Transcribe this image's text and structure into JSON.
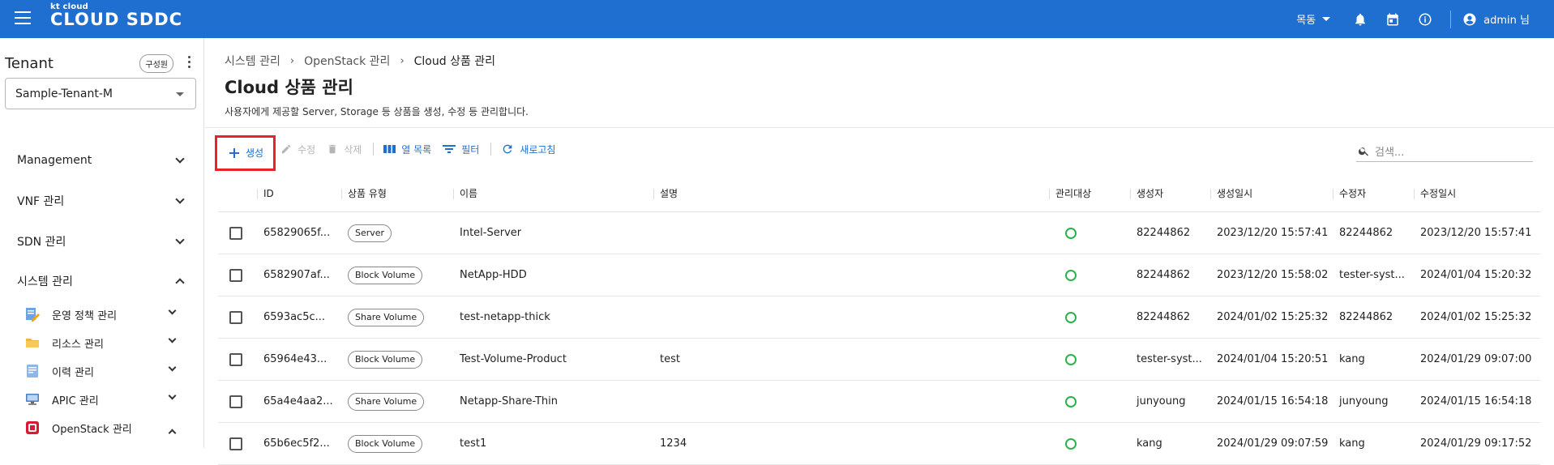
{
  "header": {
    "brand_small": "kt cloud",
    "brand_name": "CLOUD SDDC",
    "region": "목동",
    "user": "admin 님"
  },
  "sidebar": {
    "tenant_label": "Tenant",
    "member_chip": "구성원",
    "tenant_selected": "Sample-Tenant-M",
    "nav": [
      {
        "label": "Management"
      },
      {
        "label": "VNF 관리"
      },
      {
        "label": "SDN 관리"
      },
      {
        "label": "시스템 관리"
      }
    ],
    "sub": [
      {
        "label": "운영 정책 관리"
      },
      {
        "label": "리소스 관리"
      },
      {
        "label": "이력 관리"
      },
      {
        "label": "APIC 관리"
      },
      {
        "label": "OpenStack 관리"
      }
    ]
  },
  "breadcrumb": [
    "시스템 관리",
    "OpenStack 관리",
    "Cloud 상품 관리"
  ],
  "page": {
    "title": "Cloud 상품 관리",
    "description": "사용자에게 제공할 Server, Storage 등 상품을 생성, 수정 등 관리합니다."
  },
  "toolbar": {
    "create": "생성",
    "edit": "수정",
    "delete": "삭제",
    "columns": "열 목록",
    "filter": "필터",
    "refresh": "새로고침",
    "search_placeholder": "검색..."
  },
  "table": {
    "columns": [
      "ID",
      "상품 유형",
      "이름",
      "설명",
      "관리대상",
      "생성자",
      "생성일시",
      "수정자",
      "수정일시"
    ],
    "rows": [
      {
        "id": "65829065f...",
        "type": "Server",
        "name": "Intel-Server",
        "desc": "",
        "managed": true,
        "creator": "82244862",
        "created": "2023/12/20 15:57:41",
        "modifier": "82244862",
        "modified": "2023/12/20 15:57:41"
      },
      {
        "id": "6582907af...",
        "type": "Block Volume",
        "name": "NetApp-HDD",
        "desc": "",
        "managed": true,
        "creator": "82244862",
        "created": "2023/12/20 15:58:02",
        "modifier": "tester-syst...",
        "modified": "2024/01/04 15:20:32"
      },
      {
        "id": "6593ac5c...",
        "type": "Share Volume",
        "name": "test-netapp-thick",
        "desc": "",
        "managed": true,
        "creator": "82244862",
        "created": "2024/01/02 15:25:32",
        "modifier": "82244862",
        "modified": "2024/01/02 15:25:32"
      },
      {
        "id": "65964e43...",
        "type": "Block Volume",
        "name": "Test-Volume-Product",
        "desc": "test",
        "managed": true,
        "creator": "tester-syst...",
        "created": "2024/01/04 15:20:51",
        "modifier": "kang",
        "modified": "2024/01/29 09:07:00"
      },
      {
        "id": "65a4e4aa2...",
        "type": "Share Volume",
        "name": "Netapp-Share-Thin",
        "desc": "",
        "managed": true,
        "creator": "junyoung",
        "created": "2024/01/15 16:54:18",
        "modifier": "junyoung",
        "modified": "2024/01/15 16:54:18"
      },
      {
        "id": "65b6ec5f2...",
        "type": "Block Volume",
        "name": "test1",
        "desc": "1234",
        "managed": true,
        "creator": "kang",
        "created": "2024/01/29 09:07:59",
        "modifier": "kang",
        "modified": "2024/01/29 09:17:52"
      }
    ]
  },
  "colors": {
    "primary": "#1e6fcf",
    "highlight": "#e8232a",
    "ok": "#2bb34a"
  }
}
